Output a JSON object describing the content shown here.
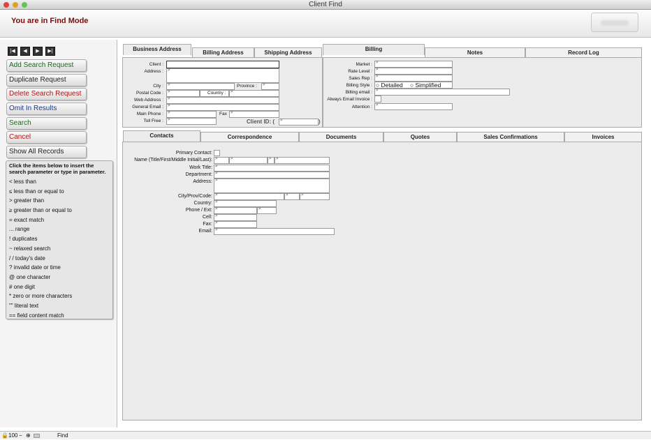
{
  "window": {
    "title": "Client Find"
  },
  "header": {
    "mode_text": "You are in Find Mode"
  },
  "sidebar": {
    "nav": [
      "|◀",
      "◀",
      "▶",
      "▶|"
    ],
    "buttons": [
      {
        "label": "Add Search Request",
        "color": "#1a6b1a"
      },
      {
        "label": "Duplicate Request",
        "color": "#222222"
      },
      {
        "label": "Delete Search Request",
        "color": "#b01414"
      },
      {
        "label": "Omit In Results",
        "color": "#1a3a8a"
      },
      {
        "label": "Search",
        "color": "#1a6b1a"
      },
      {
        "label": "Cancel",
        "color": "#b01414"
      },
      {
        "label": "Show All Records",
        "color": "#222222"
      }
    ],
    "help": "Click the items below to insert the search parameter or type in parameter.",
    "operators": [
      "< less than",
      "≤ less than or equal to",
      "> greater than",
      "≥ greater than or equal to",
      "= exact match",
      "... range",
      "! duplicates",
      "~ relaxed search",
      "/ / today's date",
      "? invalid date or time",
      "@ one character",
      "# one digit",
      "* zero or more characters",
      "\"\" literal text",
      "== field content match"
    ]
  },
  "address_tabs": [
    "Business Address",
    "Billing Address",
    "Shipping Address"
  ],
  "address_fields": {
    "client": "Client :",
    "address": "Address :",
    "city": "City :",
    "province": "Province :",
    "postal": "Postal Code :",
    "country": "Country :",
    "web": "Web Address :",
    "email": "General Email :",
    "phone": "Main Phone :",
    "fax": "Fax",
    "tollfree": "Toll Free :",
    "client_id": "Client ID: (",
    "client_id_close": ")"
  },
  "info_tabs": [
    "Billing",
    "Notes",
    "Record Log"
  ],
  "billing_fields": {
    "market": "Market :",
    "rate": "Rate Level :",
    "rep": "Sales Rep :",
    "style": "Billing Style :",
    "style_opt1": "Detailed",
    "style_opt2": "Simplified",
    "bemail": "Billing email :",
    "always": "Always Email Invoice :",
    "attention": "Attention :"
  },
  "bottom_tabs": [
    "Contacts",
    "Correspondence",
    "Documents",
    "Quotes",
    "Sales Confirmations",
    "Invoices"
  ],
  "contact_fields": {
    "primary": "Primary Contact:",
    "name": "Name (Title/First/Middle Initial/Last):",
    "worktitle": "Work Title:",
    "dept": "Department:",
    "address": "Address:",
    "city": "City/Prov/Code:",
    "country": "Country:",
    "phone": "Phone / Ext:",
    "cell": "Cell:",
    "fax": "Fax:",
    "email": "Email:"
  },
  "status": {
    "zoom": "100",
    "mode": "Find"
  }
}
